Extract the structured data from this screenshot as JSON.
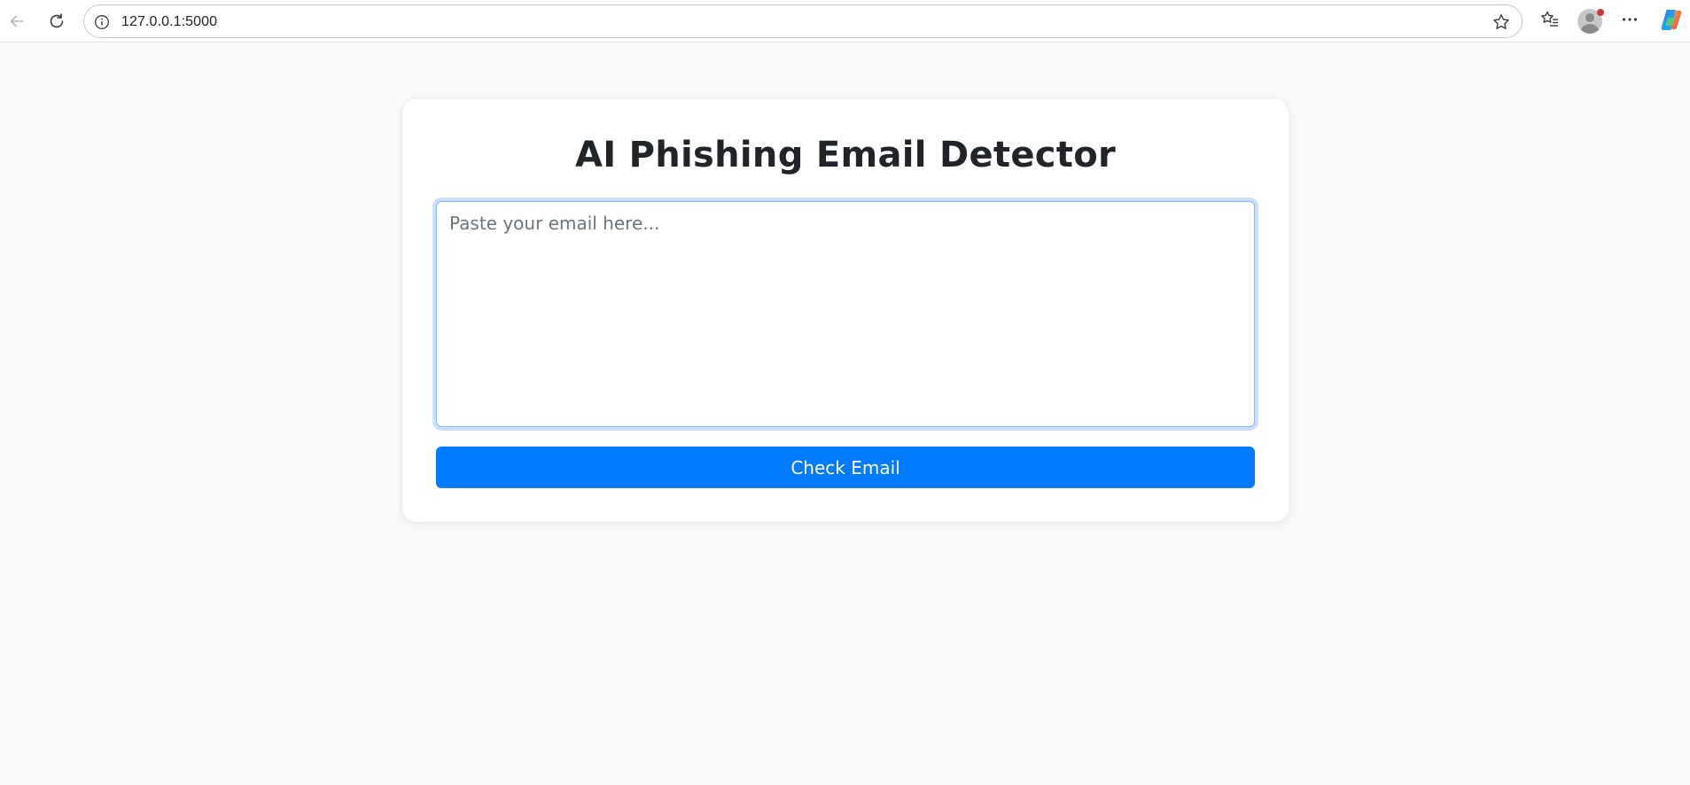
{
  "browser": {
    "url": "127.0.0.1:5000",
    "icons": {
      "back": "back-arrow-icon",
      "reload": "reload-icon",
      "site_info": "info-icon",
      "favorite": "star-icon",
      "favorites": "favorites-list-icon",
      "profile": "avatar-icon",
      "menu": "more-icon",
      "copilot": "copilot-icon"
    },
    "notification_color": "#d13438"
  },
  "page": {
    "title": "AI Phishing Email Detector",
    "email_input": {
      "placeholder": "Paste your email here...",
      "value": ""
    },
    "submit_label": "Check Email"
  },
  "colors": {
    "background": "#f8f9fa",
    "card": "#ffffff",
    "accent": "#007bff",
    "focus_border": "#86b7fe"
  }
}
